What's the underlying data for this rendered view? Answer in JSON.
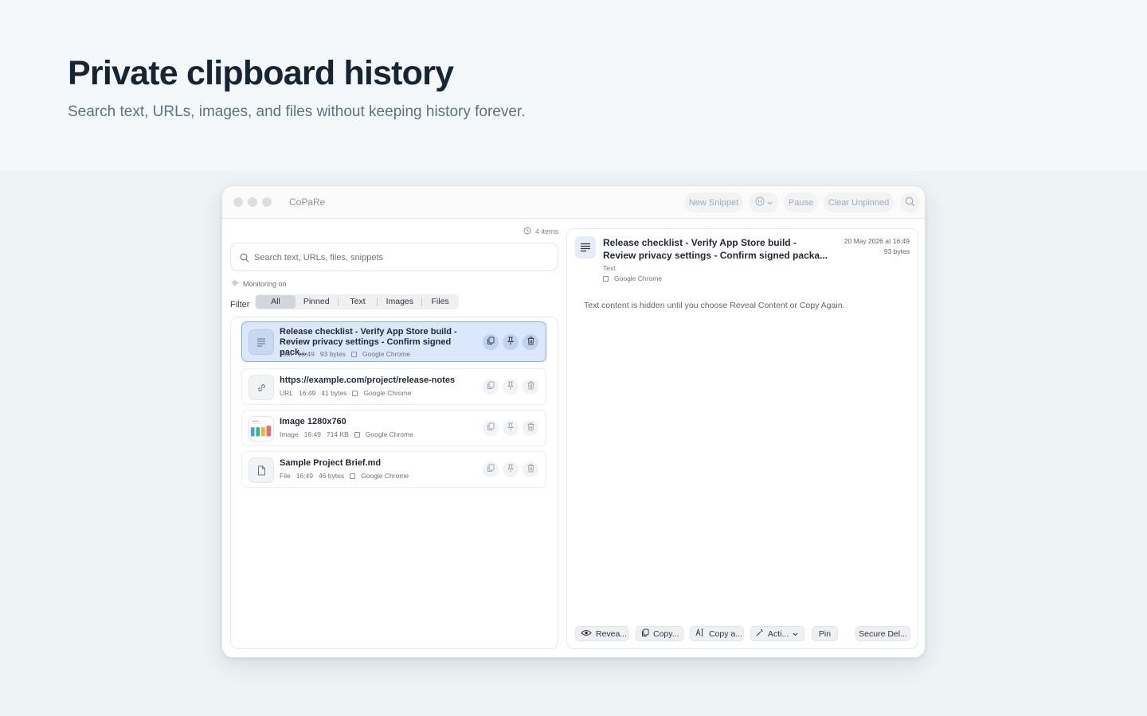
{
  "hero": {
    "title": "Private clipboard history",
    "subtitle": "Search text, URLs, images, and files without keeping history forever."
  },
  "window": {
    "app_name": "CoPaRe",
    "toolbar": {
      "new_snippet": "New Snippet",
      "pause": "Pause",
      "clear_unpinned": "Clear Unpinned"
    }
  },
  "sidebar": {
    "items_count": "4 items",
    "search_placeholder": "Search text, URLs, files, snippets",
    "monitoring": "Monitoring on",
    "filter_label": "Filter",
    "filters": [
      "All",
      "Pinned",
      "Text",
      "Images",
      "Files"
    ],
    "active_filter": "All"
  },
  "items": [
    {
      "title_line1": "Release checklist - Verify App Store build -",
      "title_line2": "Review privacy settings - Confirm signed pack...",
      "type": "Text",
      "time": "16:49",
      "size": "93 bytes",
      "source": "Google Chrome",
      "icon": "text-lines-icon",
      "selected": true
    },
    {
      "title_line1": "https://example.com/project/release-notes",
      "title_line2": "",
      "type": "URL",
      "time": "16:49",
      "size": "41 bytes",
      "source": "Google Chrome",
      "icon": "link-icon",
      "selected": false
    },
    {
      "title_line1": "Image 1280x760",
      "title_line2": "",
      "type": "Image",
      "time": "16:49",
      "size": "714 KB",
      "source": "Google Chrome",
      "icon": "image-thumbnail",
      "selected": false
    },
    {
      "title_line1": "Sample Project Brief.md",
      "title_line2": "",
      "type": "File",
      "time": "16:49",
      "size": "46 bytes",
      "source": "Google Chrome",
      "icon": "document-icon",
      "selected": false
    }
  ],
  "detail": {
    "title_line1": "Release checklist - Verify App Store build -",
    "title_line2": "Review privacy settings - Confirm signed packa...",
    "date": "20 May 2026 at 16:49",
    "size": "93 bytes",
    "type": "Text",
    "source": "Google Chrome",
    "hidden_notice": "Text content is hidden until you choose Reveal Content or Copy Again.",
    "actions": {
      "reveal": "Revea...",
      "copy": "Copy...",
      "copy_as": "Copy a...",
      "actions": "Acti...",
      "pin": "Pin",
      "secure_delete": "Secure Del..."
    }
  },
  "colors": {
    "accent_selected_bg": "#dbe7fd",
    "accent_selected_border": "#86aef2",
    "hero_title": "#162534"
  }
}
